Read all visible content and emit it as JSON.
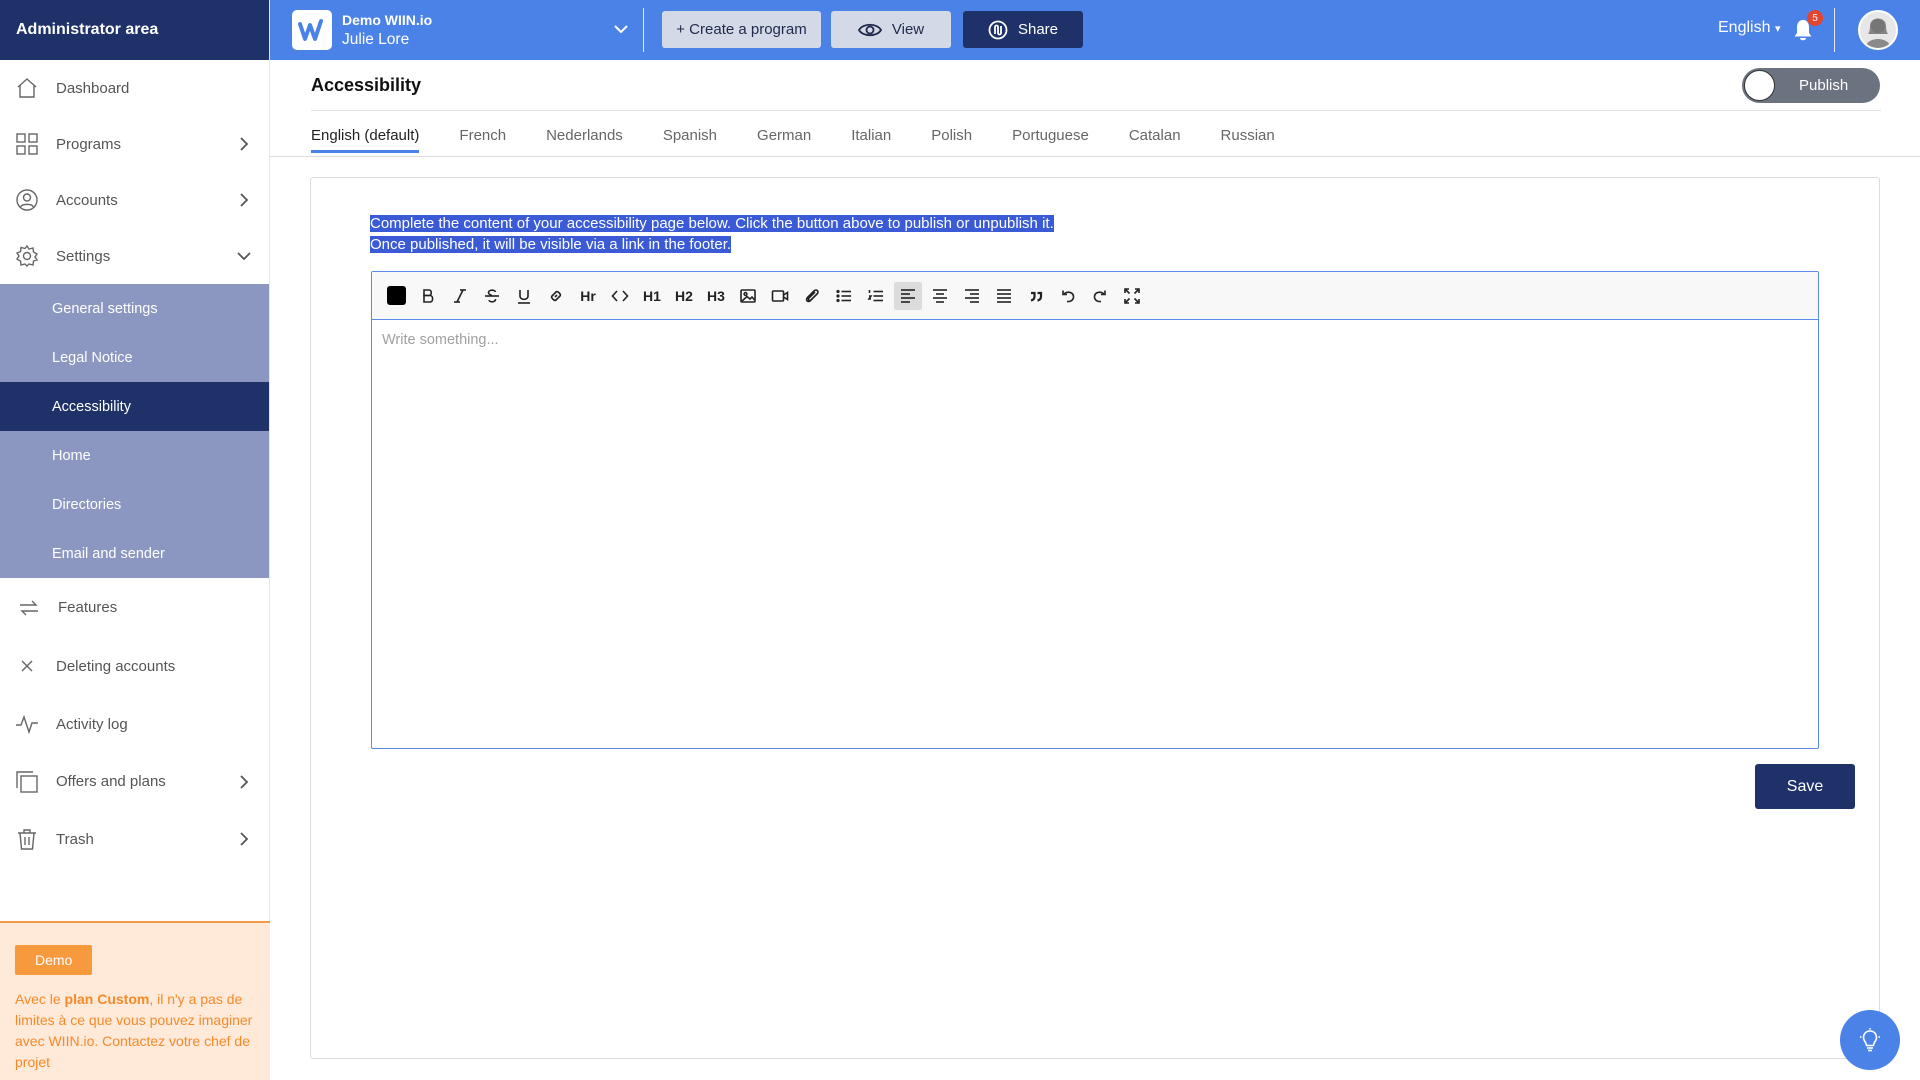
{
  "sidebar": {
    "header": "Administrator area",
    "items": [
      {
        "label": "Dashboard",
        "icon": "home-icon"
      },
      {
        "label": "Programs",
        "icon": "grid-icon"
      },
      {
        "label": "Accounts",
        "icon": "user-circle-icon"
      },
      {
        "label": "Settings",
        "icon": "gear-icon"
      }
    ],
    "settings_sub": [
      "General settings",
      "Legal Notice",
      "Accessibility",
      "Home",
      "Directories",
      "Email and sender"
    ],
    "items_after": [
      {
        "label": "Features",
        "icon": "swap-arrows-icon"
      },
      {
        "label": "Deleting accounts",
        "icon": "close-icon"
      },
      {
        "label": "Activity log",
        "icon": "pulse-icon"
      },
      {
        "label": "Offers and plans",
        "icon": "layers-icon"
      },
      {
        "label": "Trash",
        "icon": "trash-icon"
      }
    ],
    "footer": {
      "badge": "Demo",
      "promo_pre": "Avec le ",
      "promo_strong": "plan Custom",
      "promo_post": ", il n'y a pas de limites à ce que vous pouvez imaginer avec WIIN.io. Contactez votre chef de projet"
    }
  },
  "topbar": {
    "org_name": "Demo WIIN.io",
    "user_name": "Julie Lore",
    "create_label": "+ Create a program",
    "view_label": "View",
    "share_label": "Share",
    "language": "English",
    "notifications": "5"
  },
  "page": {
    "title": "Accessibility",
    "publish_label": "Publish",
    "tabs": [
      "English (default)",
      "French",
      "Nederlands",
      "Spanish",
      "German",
      "Italian",
      "Polish",
      "Portuguese",
      "Catalan",
      "Russian"
    ],
    "intro_line1": "Complete the content of your accessibility page below. Click the button above to publish or unpublish it.",
    "intro_line2": "Once published, it will be visible via a link in the footer.",
    "editor_placeholder": "Write something...",
    "toolbar": {
      "hr": "Hr",
      "h1": "H1",
      "h2": "H2",
      "h3": "H3"
    },
    "save_label": "Save"
  },
  "colors": {
    "brand_dark": "#1e3168",
    "brand_blue": "#4b82e8",
    "sub_menu": "#8b97c0",
    "promo_orange": "#f79a3e"
  }
}
